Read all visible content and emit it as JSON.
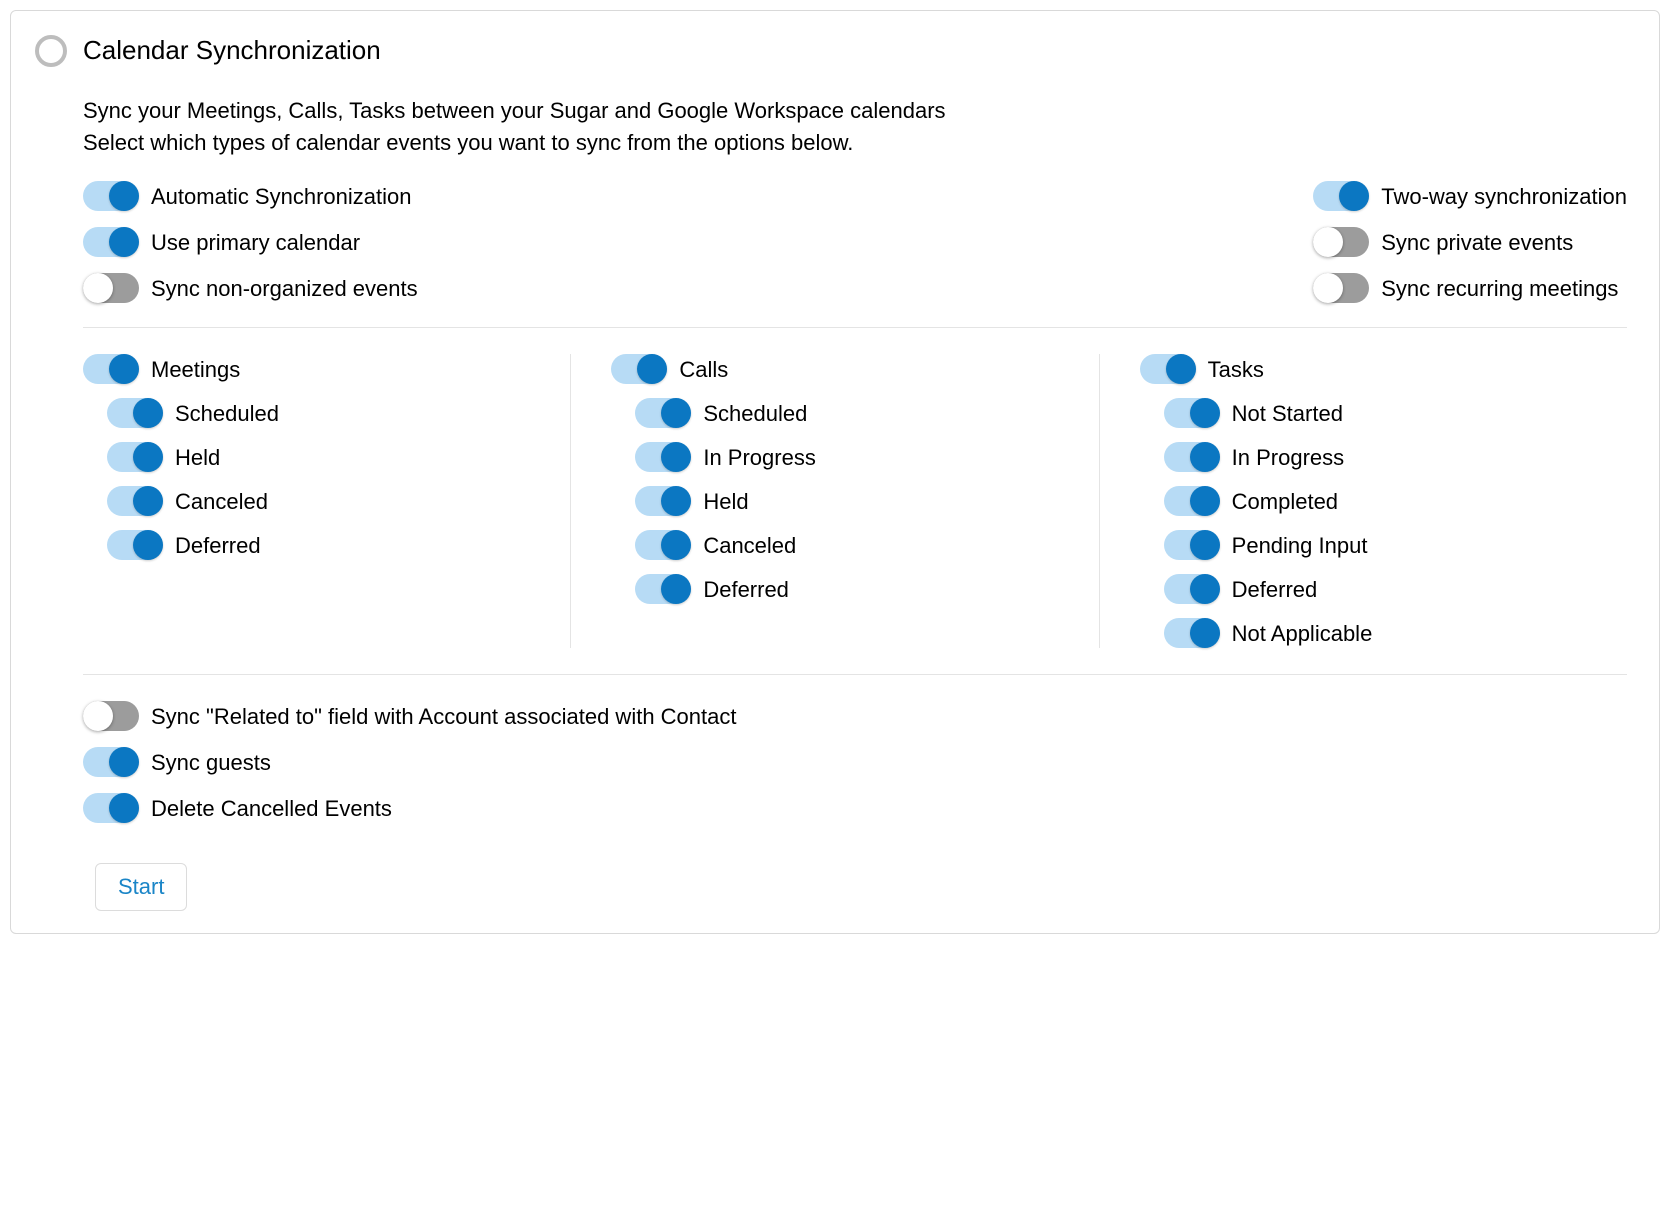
{
  "panel": {
    "title": "Calendar Synchronization",
    "intro_line1": "Sync your Meetings, Calls, Tasks between your Sugar and Google Workspace calendars",
    "intro_line2": "Select which types of calendar events you want to sync from the options below."
  },
  "top": {
    "left": [
      {
        "name": "automatic-sync",
        "label": "Automatic Synchronization",
        "on": true
      },
      {
        "name": "use-primary-calendar",
        "label": "Use primary calendar",
        "on": true
      },
      {
        "name": "sync-non-organized",
        "label": "Sync non-organized events",
        "on": false
      }
    ],
    "right": [
      {
        "name": "two-way-sync",
        "label": "Two-way synchronization",
        "on": true
      },
      {
        "name": "sync-private-events",
        "label": "Sync private events",
        "on": false
      },
      {
        "name": "sync-recurring",
        "label": "Sync recurring meetings",
        "on": false
      }
    ]
  },
  "modules": {
    "meetings": {
      "name": "meetings",
      "label": "Meetings",
      "on": true,
      "subs": [
        {
          "name": "meetings-scheduled",
          "label": "Scheduled",
          "on": true
        },
        {
          "name": "meetings-held",
          "label": "Held",
          "on": true
        },
        {
          "name": "meetings-canceled",
          "label": "Canceled",
          "on": true
        },
        {
          "name": "meetings-deferred",
          "label": "Deferred",
          "on": true
        }
      ]
    },
    "calls": {
      "name": "calls",
      "label": "Calls",
      "on": true,
      "subs": [
        {
          "name": "calls-scheduled",
          "label": "Scheduled",
          "on": true
        },
        {
          "name": "calls-in-progress",
          "label": "In Progress",
          "on": true
        },
        {
          "name": "calls-held",
          "label": "Held",
          "on": true
        },
        {
          "name": "calls-canceled",
          "label": "Canceled",
          "on": true
        },
        {
          "name": "calls-deferred",
          "label": "Deferred",
          "on": true
        }
      ]
    },
    "tasks": {
      "name": "tasks",
      "label": "Tasks",
      "on": true,
      "subs": [
        {
          "name": "tasks-not-started",
          "label": "Not Started",
          "on": true
        },
        {
          "name": "tasks-in-progress",
          "label": "In Progress",
          "on": true
        },
        {
          "name": "tasks-completed",
          "label": "Completed",
          "on": true
        },
        {
          "name": "tasks-pending-input",
          "label": "Pending Input",
          "on": true
        },
        {
          "name": "tasks-deferred",
          "label": "Deferred",
          "on": true
        },
        {
          "name": "tasks-not-applicable",
          "label": "Not Applicable",
          "on": true
        }
      ]
    }
  },
  "extras": [
    {
      "name": "sync-related-to",
      "label": "Sync \"Related to\" field with Account associated with Contact",
      "on": false
    },
    {
      "name": "sync-guests",
      "label": "Sync guests",
      "on": true
    },
    {
      "name": "delete-cancelled",
      "label": "Delete Cancelled Events",
      "on": true
    }
  ],
  "button": {
    "start_label": "Start"
  }
}
